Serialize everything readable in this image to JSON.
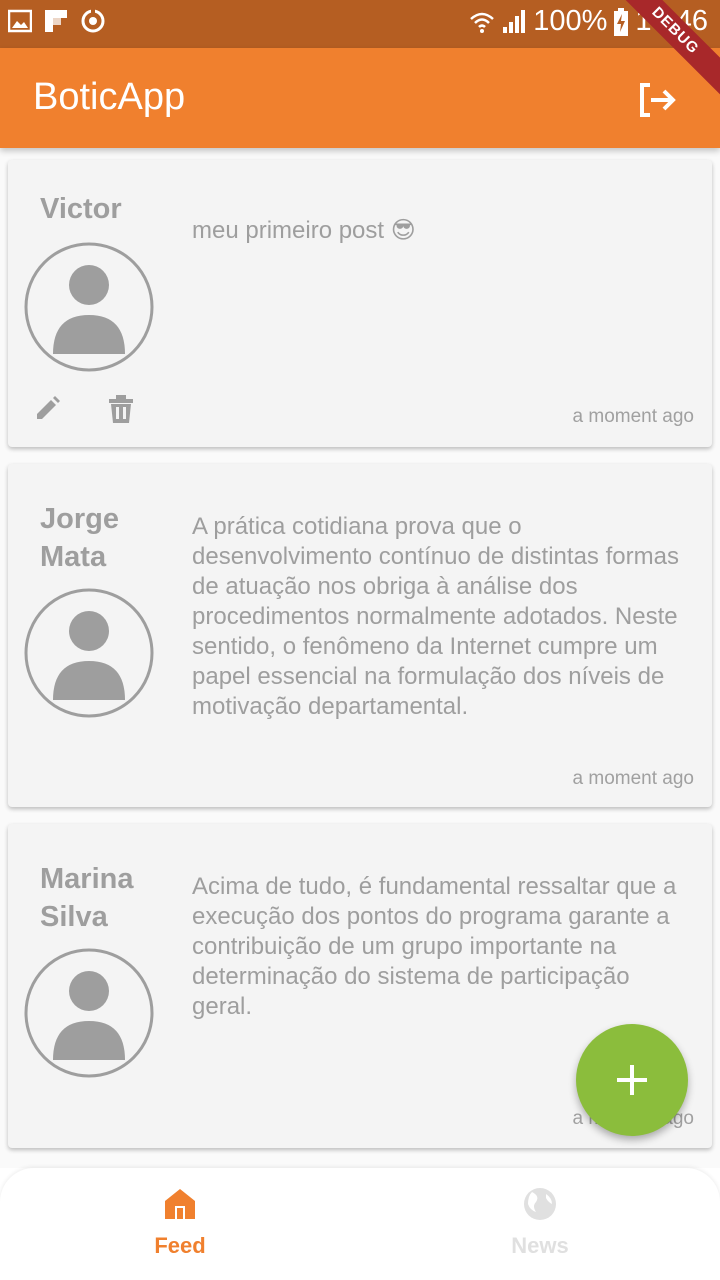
{
  "status_bar": {
    "battery": "100%",
    "time": "17:46",
    "icons": [
      "gallery-icon",
      "flipboard-icon",
      "sync-icon",
      "wifi-icon",
      "signal-icon",
      "battery-charging-icon"
    ]
  },
  "debug_banner": "DEBUG",
  "app_bar": {
    "title": "BoticApp",
    "action_icon": "logout-icon"
  },
  "posts": [
    {
      "author": "Victor",
      "text": "meu primeiro post 😎",
      "timestamp": "a moment ago",
      "actions": [
        "edit-icon",
        "delete-icon"
      ]
    },
    {
      "author": "Jorge Mata",
      "text": " A prática cotidiana prova que o desenvolvimento contínuo de distintas formas de atuação nos obriga à análise dos procedimentos normalmente adotados. Neste sentido, o fenômeno da Internet cumpre um papel essencial na formulação dos níveis de motivação departamental.",
      "timestamp": "a moment ago"
    },
    {
      "author": "Marina Silva",
      "text": "Acima de tudo, é fundamental ressaltar que a execução dos pontos do programa garante a contribuição de um grupo importante na determinação do sistema de participação geral.",
      "timestamp": "a moment ago"
    }
  ],
  "fab": {
    "icon": "add-icon"
  },
  "bottom_nav": {
    "items": [
      {
        "label": "Feed",
        "icon": "home-icon",
        "selected": true
      },
      {
        "label": "News",
        "icon": "globe-icon",
        "selected": false
      }
    ]
  },
  "colors": {
    "status_bar": "#b55e22",
    "app_bar": "#f0802e",
    "fab": "#8bbd3c",
    "nav_active": "#f0802e",
    "nav_inactive": "#e0e0e0",
    "text_muted": "#9e9e9e",
    "card": "#f4f4f4"
  }
}
